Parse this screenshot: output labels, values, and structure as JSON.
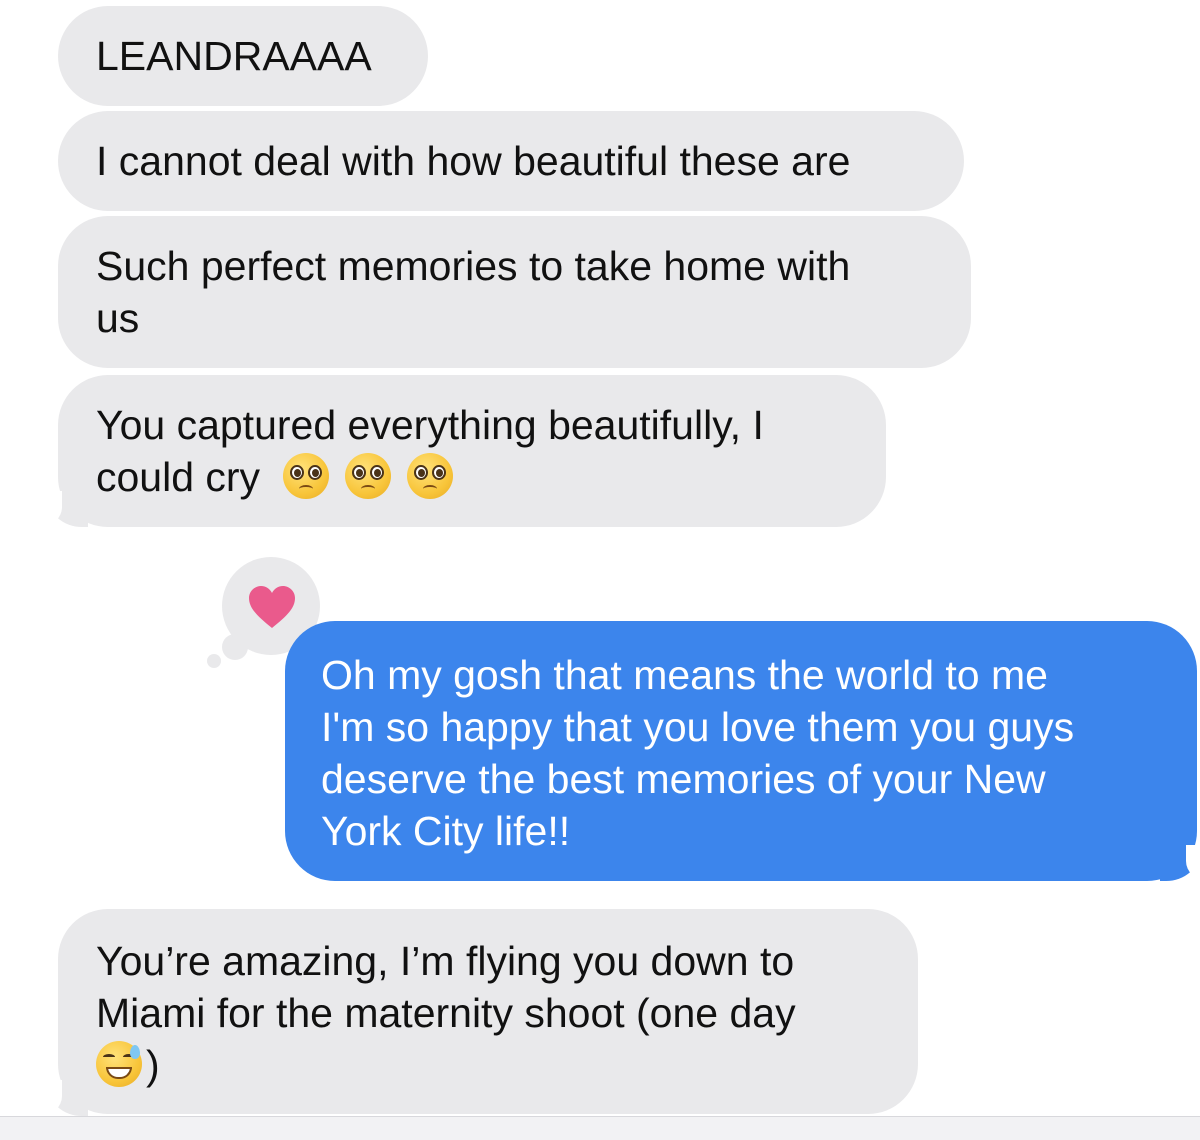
{
  "messages": [
    {
      "direction": "incoming",
      "text": "LEANDRAAAA"
    },
    {
      "direction": "incoming",
      "text": "I cannot deal with how beautiful these are"
    },
    {
      "direction": "incoming",
      "lines": [
        "Such perfect memories to take home with",
        "us"
      ]
    },
    {
      "direction": "incoming",
      "lines": [
        "You captured everything beautifully, I",
        "could cry"
      ],
      "emoji": [
        "pleading-face-emoji",
        "pleading-face-emoji",
        "pleading-face-emoji"
      ]
    },
    {
      "direction": "outgoing",
      "lines": [
        "Oh my gosh that means the world to me",
        "I'm so happy that you love them you guys",
        "deserve the best memories of your New",
        "York City life!!"
      ],
      "reaction": "heart"
    },
    {
      "direction": "incoming",
      "lines": [
        "You’re amazing, I’m flying you down to",
        "Miami for the maternity shoot (one day",
        ")"
      ],
      "emoji": [
        "grinning-sweat-emoji"
      ]
    }
  ],
  "colors": {
    "incoming_bubble": "#e9e9eb",
    "outgoing_bubble": "#3c85ec",
    "heart_reaction": "#ea5a8c"
  }
}
